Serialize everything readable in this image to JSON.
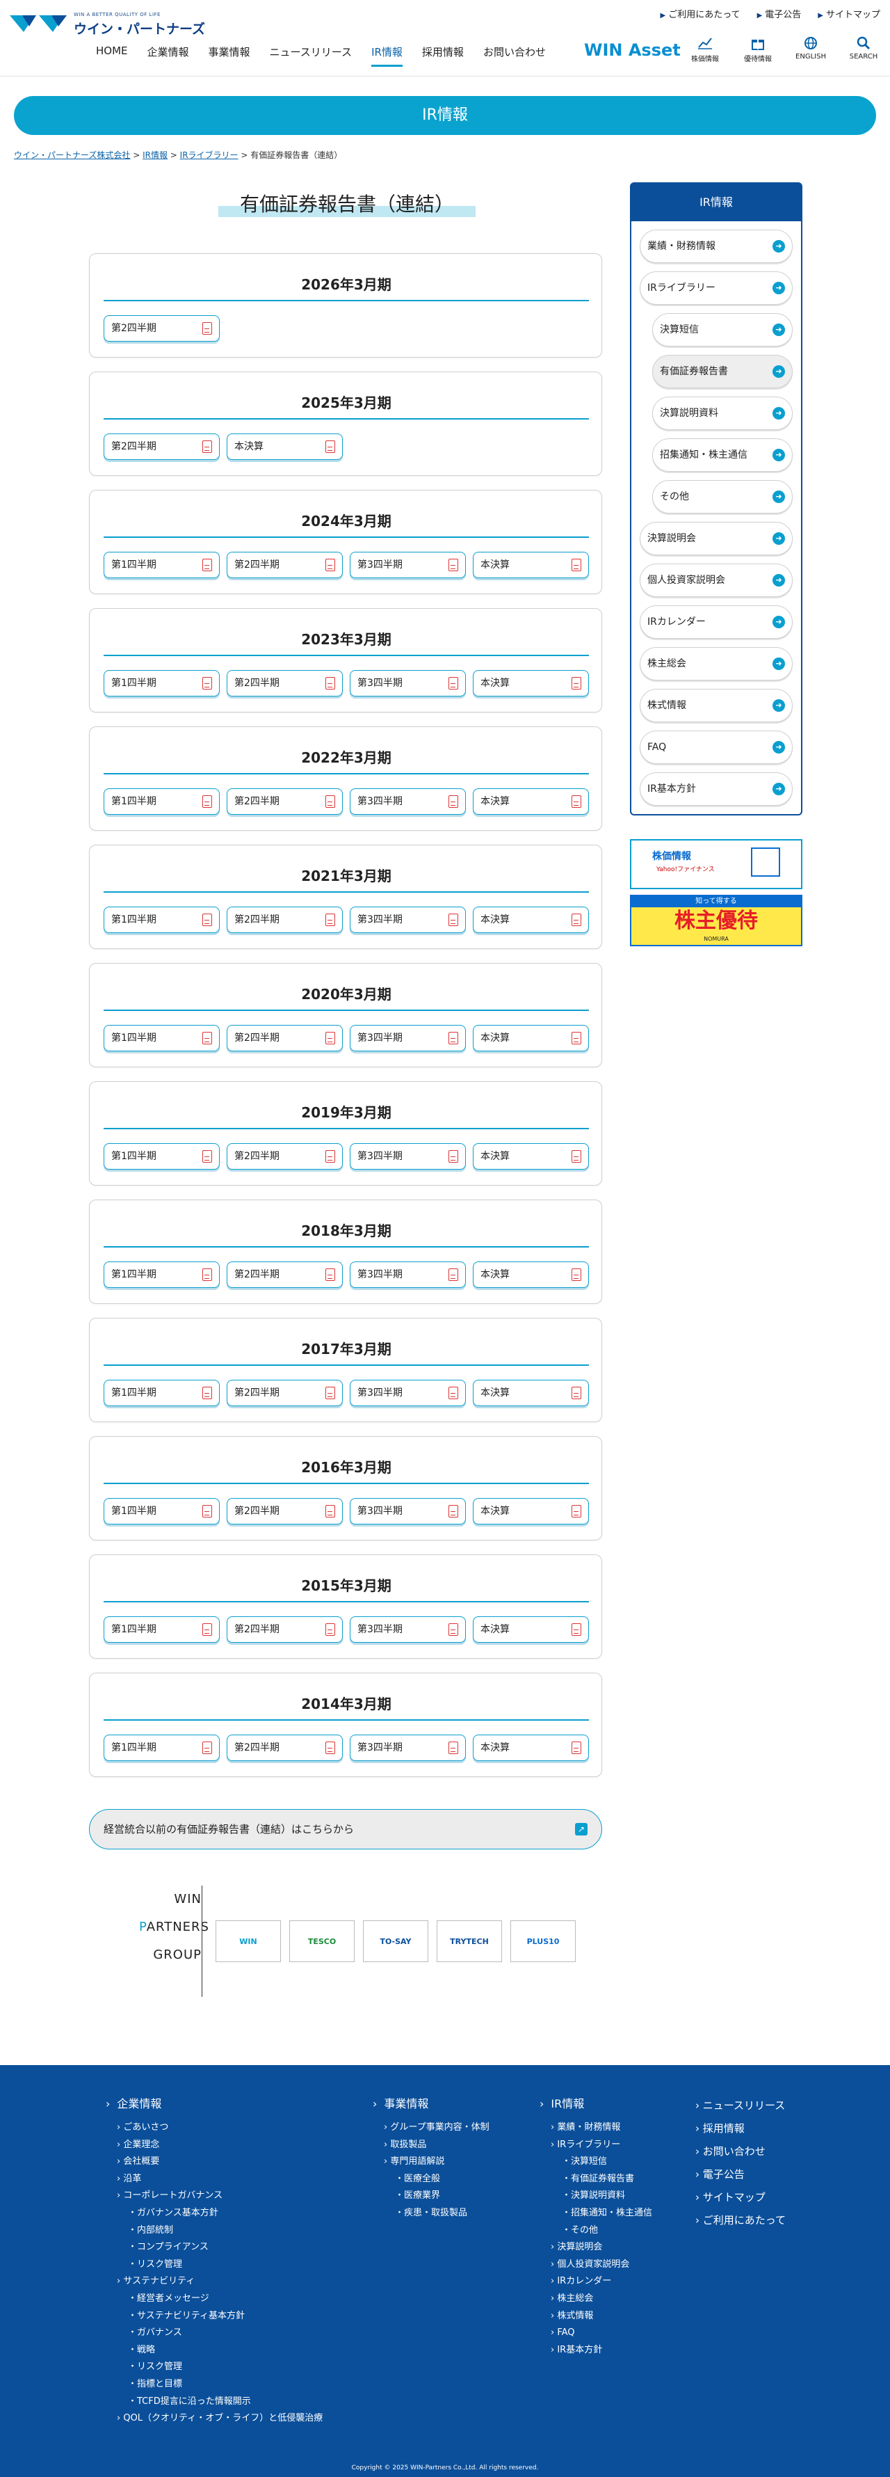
{
  "header": {
    "logo_tagline": "WIN A BETTER QUALITY OF LIFE",
    "logo_name": "ウイン・パートナーズ",
    "utility": [
      "ご利用にあたって",
      "電子公告",
      "サイトマップ"
    ],
    "nav": [
      "HOME",
      "企業情報",
      "事業情報",
      "ニュースリリース",
      "IR情報",
      "採用情報",
      "お問い合わせ"
    ],
    "nav_current": "IR情報",
    "win_asset": "WIN Asset",
    "icons": [
      {
        "label": "株価情報",
        "icon": "chart-icon"
      },
      {
        "label": "優待情報",
        "icon": "gift-icon"
      },
      {
        "label": "ENGLISH",
        "icon": "globe-icon"
      },
      {
        "label": "SEARCH",
        "icon": "search-icon"
      }
    ]
  },
  "band_title": "IR情報",
  "breadcrumb": {
    "links": [
      "ウイン・パートナーズ株式会社",
      "IR情報",
      "IRライブラリー"
    ],
    "sep": " > ",
    "current": "有価証券報告書（連結）"
  },
  "page_title": "有価証券報告書（連結）",
  "periods": [
    {
      "title": "2026年3月期",
      "buttons": [
        "第2四半期"
      ]
    },
    {
      "title": "2025年3月期",
      "buttons": [
        "第2四半期",
        "本決算"
      ]
    },
    {
      "title": "2024年3月期",
      "buttons": [
        "第1四半期",
        "第2四半期",
        "第3四半期",
        "本決算"
      ]
    },
    {
      "title": "2023年3月期",
      "buttons": [
        "第1四半期",
        "第2四半期",
        "第3四半期",
        "本決算"
      ]
    },
    {
      "title": "2022年3月期",
      "buttons": [
        "第1四半期",
        "第2四半期",
        "第3四半期",
        "本決算"
      ]
    },
    {
      "title": "2021年3月期",
      "buttons": [
        "第1四半期",
        "第2四半期",
        "第3四半期",
        "本決算"
      ]
    },
    {
      "title": "2020年3月期",
      "buttons": [
        "第1四半期",
        "第2四半期",
        "第3四半期",
        "本決算"
      ]
    },
    {
      "title": "2019年3月期",
      "buttons": [
        "第1四半期",
        "第2四半期",
        "第3四半期",
        "本決算"
      ]
    },
    {
      "title": "2018年3月期",
      "buttons": [
        "第1四半期",
        "第2四半期",
        "第3四半期",
        "本決算"
      ]
    },
    {
      "title": "2017年3月期",
      "buttons": [
        "第1四半期",
        "第2四半期",
        "第3四半期",
        "本決算"
      ]
    },
    {
      "title": "2016年3月期",
      "buttons": [
        "第1四半期",
        "第2四半期",
        "第3四半期",
        "本決算"
      ]
    },
    {
      "title": "2015年3月期",
      "buttons": [
        "第1四半期",
        "第2四半期",
        "第3四半期",
        "本決算"
      ]
    },
    {
      "title": "2014年3月期",
      "buttons": [
        "第1四半期",
        "第2四半期",
        "第3四半期",
        "本決算"
      ]
    }
  ],
  "old_link": "経営統合以前の有価証券報告書（連結）はこちらから",
  "group": {
    "lines": [
      "WIN",
      "PARTNERS",
      "GROUP"
    ],
    "logos": [
      "WIN",
      "TESCO",
      "TO-SAY",
      "TRYTECH",
      "PLUS10"
    ]
  },
  "sidebar": {
    "title": "IR情報",
    "items": [
      {
        "label": "業績・財務情報",
        "sub": false,
        "active": false
      },
      {
        "label": "IRライブラリー",
        "sub": false,
        "active": false
      },
      {
        "label": "決算短信",
        "sub": true,
        "active": false
      },
      {
        "label": "有価証券報告書",
        "sub": true,
        "active": true
      },
      {
        "label": "決算説明資料",
        "sub": true,
        "active": false
      },
      {
        "label": "招集通知・株主通信",
        "sub": true,
        "active": false
      },
      {
        "label": "その他",
        "sub": true,
        "active": false
      },
      {
        "label": "決算説明会",
        "sub": false,
        "active": false
      },
      {
        "label": "個人投資家説明会",
        "sub": false,
        "active": false
      },
      {
        "label": "IRカレンダー",
        "sub": false,
        "active": false
      },
      {
        "label": "株主総会",
        "sub": false,
        "active": false
      },
      {
        "label": "株式情報",
        "sub": false,
        "active": false
      },
      {
        "label": "FAQ",
        "sub": false,
        "active": false
      },
      {
        "label": "IR基本方針",
        "sub": false,
        "active": false
      }
    ],
    "banner1": {
      "title": "株価情報",
      "sub": "Yahoo!ファイナンス"
    },
    "banner2": {
      "top": "知って得する",
      "main": "株主優待",
      "bottom": "NOMURA"
    }
  },
  "footer": {
    "cols": [
      {
        "head": "企業情報",
        "links": [
          "ごあいさつ",
          "企業理念",
          "会社概要",
          "沿革",
          "コーポレートガバナンス",
          "・ガバナンス基本方針",
          "・内部統制",
          "・コンプライアンス",
          "・リスク管理",
          "サステナビリティ",
          "・経営者メッセージ",
          "・サステナビリティ基本方針",
          "・ガバナンス",
          "・戦略",
          "・リスク管理",
          "・指標と目標",
          "・TCFD提言に沿った情報開示",
          "QOL（クオリティ・オブ・ライフ）と低侵襲治療"
        ]
      },
      {
        "head": "事業情報",
        "links": [
          "グループ事業内容・体制",
          "取扱製品",
          "専門用語解説",
          "・医療全般",
          "・医療業界",
          "・疾患・取扱製品"
        ]
      },
      {
        "head": "IR情報",
        "links": [
          "業績・財務情報",
          "IRライブラリー",
          "・決算短信",
          "・有価証券報告書",
          "・決算説明資料",
          "・招集通知・株主通信",
          "・その他",
          "決算説明会",
          "個人投資家説明会",
          "IRカレンダー",
          "株主総会",
          "株式情報",
          "FAQ",
          "IR基本方針"
        ]
      },
      {
        "head": "",
        "links": [
          "ニュースリリース",
          "採用情報",
          "お問い合わせ",
          "電子公告",
          "サイトマップ",
          "ご利用にあたって"
        ]
      }
    ],
    "copyright": "Copyright © 2025 WIN-Partners Co.,Ltd. All rights reserved."
  }
}
